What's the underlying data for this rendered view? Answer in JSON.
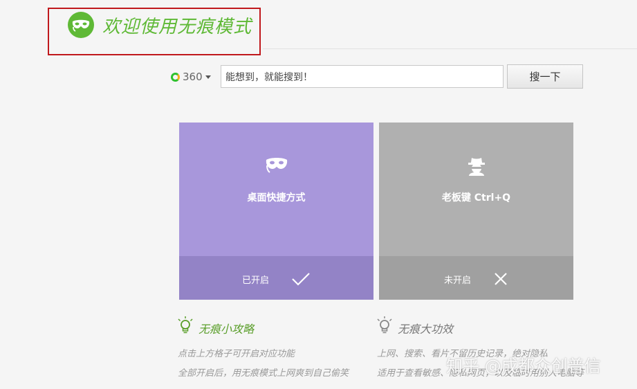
{
  "header": {
    "title": "欢迎使用无痕模式",
    "logo_icon": "mask-icon",
    "accent_color": "#5fb936",
    "highlight_color": "#c0181c"
  },
  "search": {
    "engine_name": "360",
    "value": "能想到，就能搜到！",
    "button_label": "搜一下"
  },
  "tiles": [
    {
      "icon": "mask-icon",
      "title": "桌面快捷方式",
      "status": "已开启",
      "status_icon": "check-icon",
      "color": "#a897db"
    },
    {
      "icon": "boss-key-icon",
      "title": "老板键 Ctrl+Q",
      "status": "未开启",
      "status_icon": "close-icon",
      "color": "#b0b0b0"
    }
  ],
  "tips": {
    "title": "无痕小攻略",
    "icon": "lightbulb-icon",
    "lines": [
      "点击上方格子可开启对应功能",
      "全部开启后，用无痕模式上网爽到自己偷笑"
    ]
  },
  "benefits": {
    "title": "无痕大功效",
    "icon": "lightbulb-icon",
    "lines": [
      "上网、搜索、看片不留历史记录，绝对隐私",
      "适用于查看敏感、隐私网页，以及临时用别人电脑等"
    ]
  },
  "watermark": "知乎 @成都众创普信"
}
